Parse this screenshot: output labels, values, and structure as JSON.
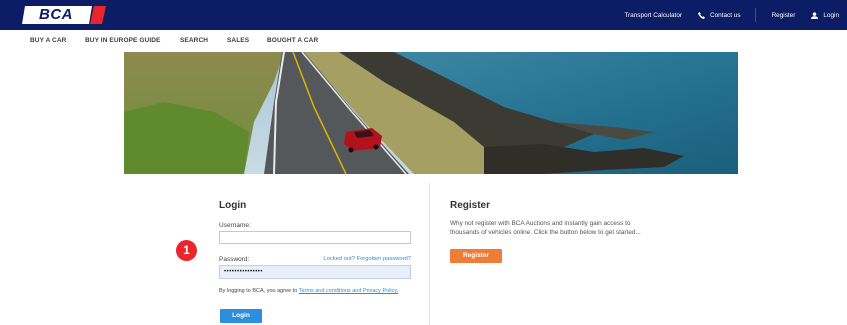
{
  "brand": {
    "logo_text": "BCA",
    "primary_color": "#0c1d66",
    "accent_red": "#e8262c"
  },
  "topbar": {
    "transport": "Transport Calculator",
    "contact": "Contact us",
    "register": "Register",
    "login": "Login"
  },
  "nav": {
    "items": [
      "BUY A CAR",
      "BUY IN EUROPE GUIDE",
      "SEARCH",
      "SALES",
      "BOUGHT A CAR"
    ]
  },
  "hero": {
    "image": "coastal-road-red-car"
  },
  "login": {
    "title": "Login",
    "username_label": "Username:",
    "username_value": "",
    "password_label": "Password:",
    "password_value": "•••••••••••••••",
    "forgot": "Locked out? Forgotten password?",
    "agree_prefix": "By logging to BCA, you agree to ",
    "agree_link": "Terms and conditions and Privacy Policy.",
    "button": "Login",
    "button_color": "#2e8ede"
  },
  "step_badge": "1",
  "register": {
    "title": "Register",
    "text": "Why not register with BCA Auctions and instantly gain access to thousands of vehicles online. Click the button below to get started...",
    "button": "Register",
    "button_color": "#ef7d3a"
  }
}
